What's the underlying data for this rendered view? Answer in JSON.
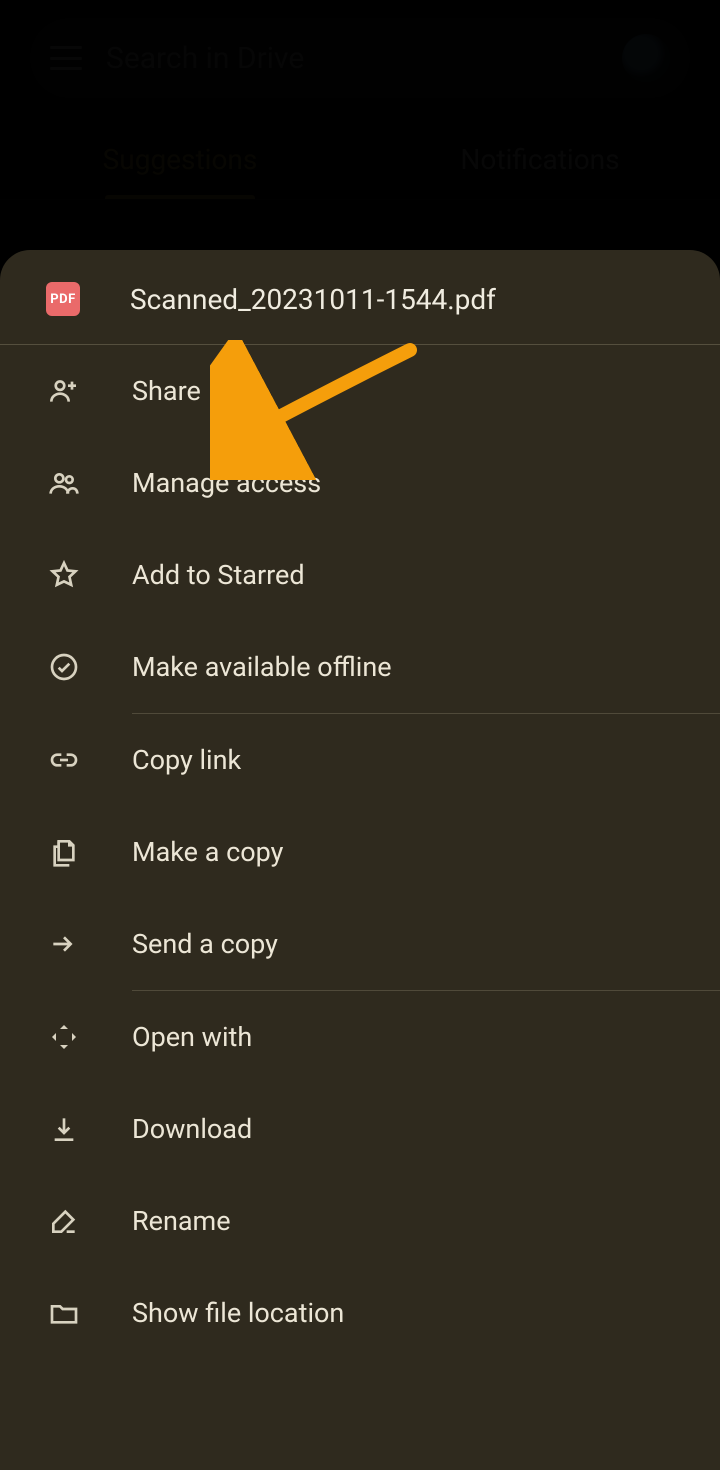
{
  "search": {
    "placeholder": "Search in Drive"
  },
  "tabs": {
    "suggestions": "Suggestions",
    "notifications": "Notifications",
    "active": "suggestions"
  },
  "sheet": {
    "file": {
      "name": "Scanned_20231011-1544.pdf",
      "badge": "PDF"
    },
    "menu": {
      "group1": [
        {
          "key": "share",
          "label": "Share",
          "icon": "person-add-icon"
        },
        {
          "key": "manage_access",
          "label": "Manage access",
          "icon": "people-icon"
        },
        {
          "key": "add_starred",
          "label": "Add to Starred",
          "icon": "star-icon"
        },
        {
          "key": "avail_offline",
          "label": "Make available offline",
          "icon": "offline-icon"
        }
      ],
      "group2": [
        {
          "key": "copy_link",
          "label": "Copy link",
          "icon": "link-icon"
        },
        {
          "key": "make_copy",
          "label": "Make a copy",
          "icon": "copy-icon"
        },
        {
          "key": "send_copy",
          "label": "Send a copy",
          "icon": "send-icon"
        }
      ],
      "group3": [
        {
          "key": "open_with",
          "label": "Open with",
          "icon": "open-with-icon"
        },
        {
          "key": "download",
          "label": "Download",
          "icon": "download-icon"
        },
        {
          "key": "rename",
          "label": "Rename",
          "icon": "rename-icon"
        },
        {
          "key": "file_location",
          "label": "Show file location",
          "icon": "folder-icon"
        }
      ]
    }
  },
  "annotation": {
    "target": "share",
    "color": "#f59e0b"
  }
}
